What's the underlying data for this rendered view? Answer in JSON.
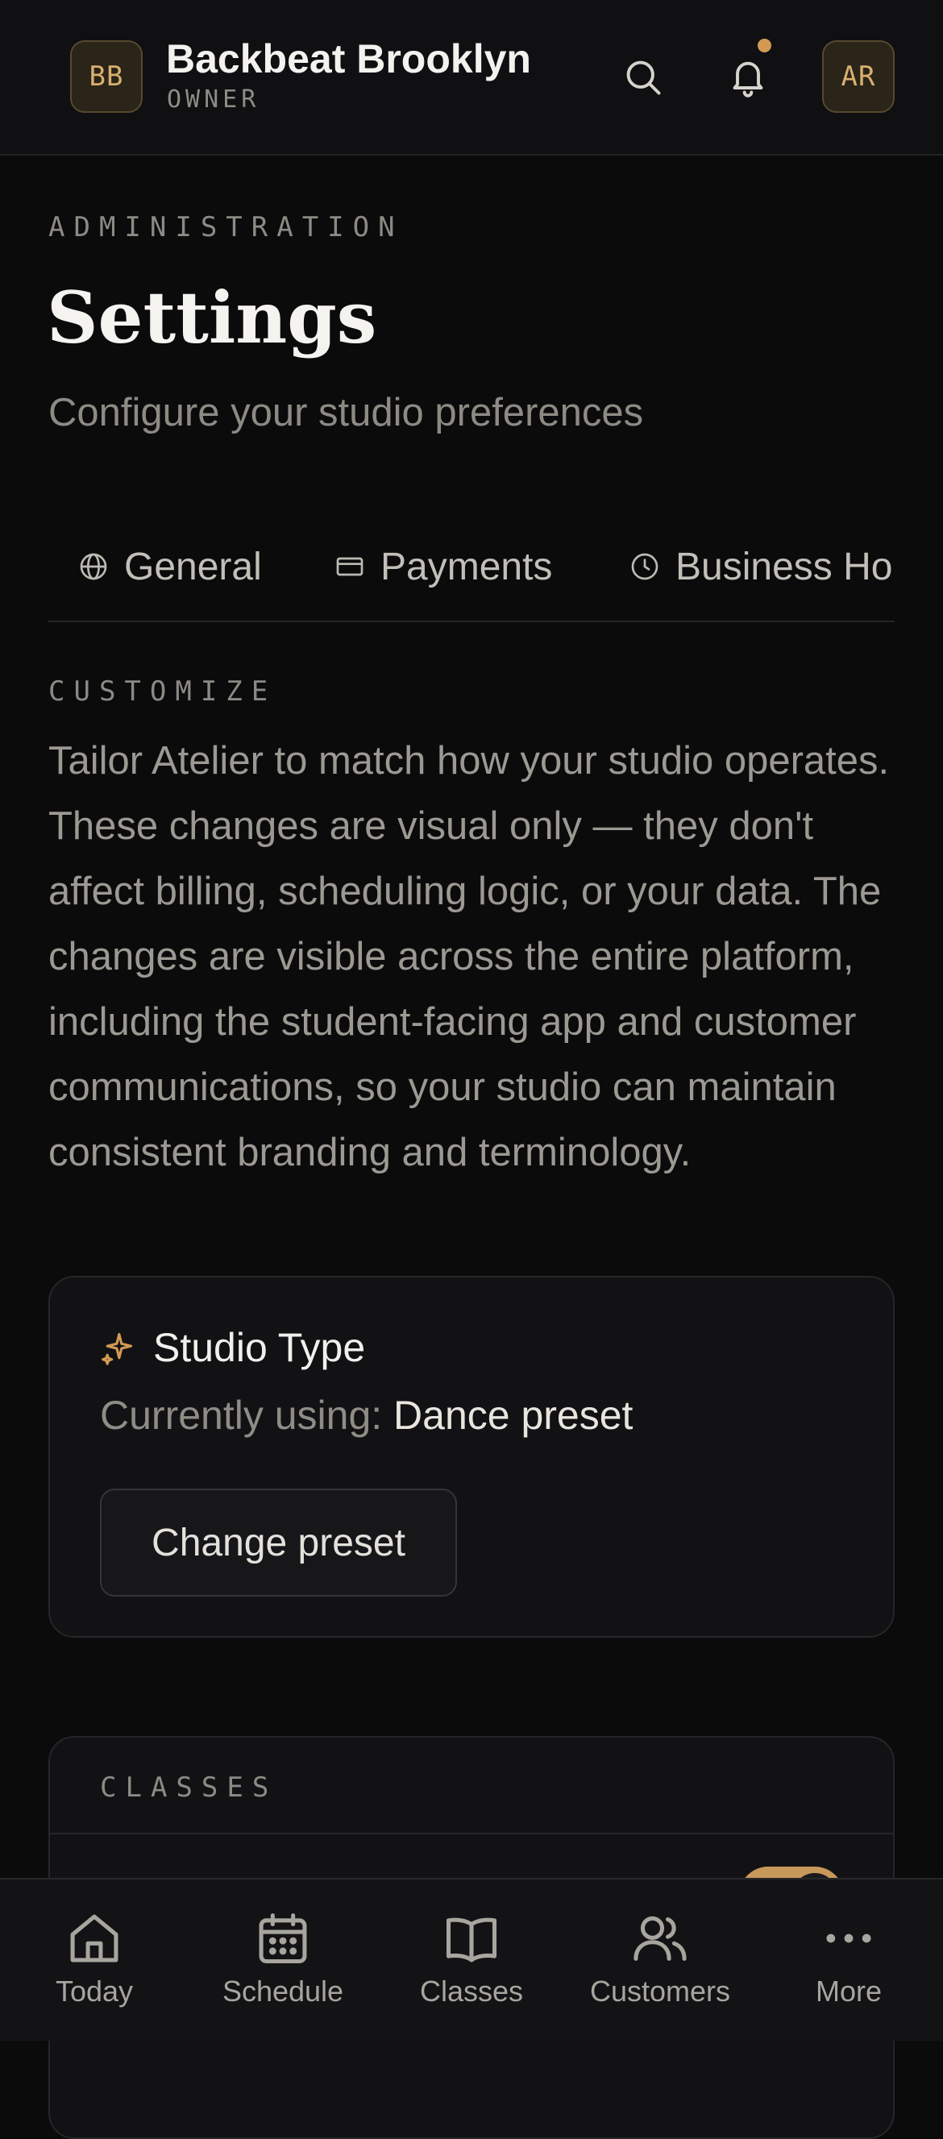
{
  "header": {
    "studio_initials": "BB",
    "studio_name": "Backbeat Brooklyn",
    "role": "OWNER",
    "user_initials": "AR",
    "has_notification": true,
    "accent_color": "#d29a54"
  },
  "page": {
    "eyebrow": "ADMINISTRATION",
    "title": "Settings",
    "subtitle": "Configure your studio preferences"
  },
  "tabs": [
    {
      "label": "General",
      "icon": "globe-icon"
    },
    {
      "label": "Payments",
      "icon": "card-icon"
    },
    {
      "label": "Business Ho",
      "icon": "clock-icon"
    }
  ],
  "customize": {
    "eyebrow": "CUSTOMIZE",
    "description": "Tailor Atelier to match how your studio operates. These changes are visual only — they don't affect billing, scheduling logic, or your data. The changes are visible across the entire platform, including the student-facing app and customer communications, so your studio can maintain consistent branding and terminology."
  },
  "studio_type": {
    "icon": "sparkles-icon",
    "title": "Studio Type",
    "current_prefix": "Currently using: ",
    "current_value": "Dance preset",
    "button_label": "Change preset"
  },
  "classes_section": {
    "eyebrow": "CLASSES",
    "toggle_on": true
  },
  "bottom_nav": [
    {
      "label": "Today",
      "icon": "home-icon"
    },
    {
      "label": "Schedule",
      "icon": "calendar-icon"
    },
    {
      "label": "Classes",
      "icon": "book-icon"
    },
    {
      "label": "Customers",
      "icon": "users-icon"
    },
    {
      "label": "More",
      "icon": "more-icon"
    }
  ]
}
